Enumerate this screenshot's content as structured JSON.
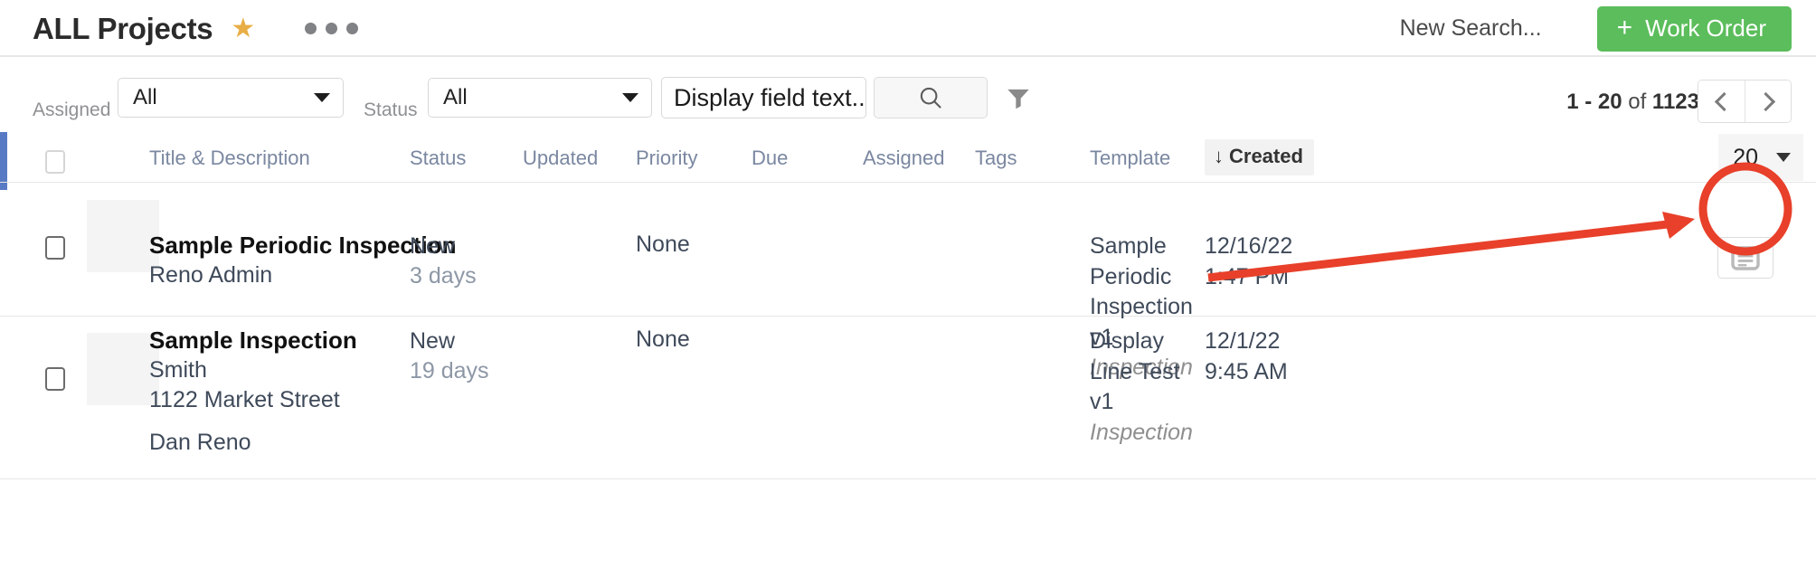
{
  "header": {
    "title": "ALL Projects",
    "star_icon": "star-icon",
    "more_icon": "ellipsis-icon",
    "new_search_label": "New Search...",
    "work_order_label": "Work Order",
    "work_order_plus": "+",
    "work_order_color": "#5bbd5b"
  },
  "filters": {
    "assigned_label": "Assigned",
    "assigned_value": "All",
    "status_label": "Status",
    "status_value": "All",
    "display_field_value": "Display field text..",
    "search_icon": "search-icon",
    "filter_icon": "funnel-icon"
  },
  "pagination": {
    "range": "1 - 20",
    "of_word": "of",
    "total": "1123",
    "prev_icon": "chevron-left-icon",
    "next_icon": "chevron-right-icon",
    "page_size": "20"
  },
  "table": {
    "columns": [
      "Title & Description",
      "Status",
      "Updated",
      "Priority",
      "Due",
      "Assigned",
      "Tags",
      "Template",
      "Created"
    ],
    "sort_column": "Created",
    "sort_arrow": "↓",
    "rows": [
      {
        "title": "Sample Periodic Inspection",
        "description_lines": [
          "Reno Admin"
        ],
        "status": "New",
        "status_age": "3 days",
        "updated": "",
        "priority": "None",
        "due": "",
        "assigned": "",
        "tags": "",
        "template_name": "Sample Periodic Inspection v1",
        "template_type": "Inspection",
        "created": "12/16/22 1:47 PM",
        "action_icon": "notes-icon"
      },
      {
        "title": "Sample Inspection",
        "description_lines": [
          "Smith",
          "1122 Market Street",
          "Dan Reno"
        ],
        "status": "New",
        "status_age": "19 days",
        "updated": "",
        "priority": "None",
        "due": "",
        "assigned": "",
        "tags": "",
        "template_name": "Display Line Test v1",
        "template_type": "Inspection",
        "created": "12/1/22 9:45 AM",
        "action_icon": ""
      }
    ]
  },
  "annotation": {
    "highlight_color": "#e8402a",
    "shape": "circle-with-arrow",
    "target": "notes-icon-row-1"
  }
}
